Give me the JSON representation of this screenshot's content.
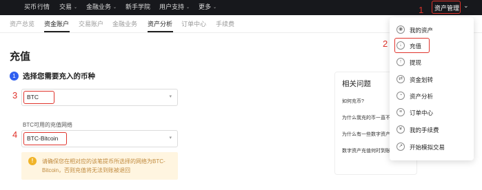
{
  "topnav": {
    "items": [
      {
        "label": "买币",
        "caret": false
      },
      {
        "label": "行情",
        "caret": false
      },
      {
        "label": "交易",
        "caret": true
      },
      {
        "label": "金融业务",
        "caret": true
      },
      {
        "label": "新手学院",
        "caret": false
      },
      {
        "label": "用户支持",
        "caret": true
      },
      {
        "label": "更多",
        "caret": true
      }
    ],
    "asset_management": "资产管理",
    "caret_glyph": "⌄",
    "user_icon": "⌄"
  },
  "annotations": [
    "1",
    "2",
    "3",
    "4"
  ],
  "subnav": {
    "tabs": [
      "资产总览",
      "资金账户",
      "交易账户",
      "金融业务",
      "资产分析",
      "订单中心",
      "手续费"
    ]
  },
  "main": {
    "title": "充值",
    "step": {
      "number": "1",
      "label": "选择您需要充入的币种"
    },
    "coin_value": "BTC",
    "network_label": "BTC可用的充值网络",
    "network_value": "BTC-Bitcoin",
    "notice": "请确保您在相对应的该笔提币所选择的网络为BTC-Bitcoin，否则充值将无法到账被退回"
  },
  "related": {
    "title": "相关问题",
    "questions": [
      "如何充币?",
      "为什么我充的币一直不到账",
      "为什么有一些数字资产",
      "数字资产充值何时到账?"
    ]
  },
  "dropdown": {
    "items": [
      {
        "label": "我的资产",
        "icon": "wallet-icon",
        "glyph": "◉"
      },
      {
        "label": "充值",
        "icon": "deposit-icon",
        "glyph": "↓"
      },
      {
        "label": "提现",
        "icon": "withdraw-icon",
        "glyph": "↑"
      },
      {
        "label": "资金划转",
        "icon": "transfer-icon",
        "glyph": "⇄"
      },
      {
        "label": "资产分析",
        "icon": "analysis-icon",
        "glyph": "◔"
      },
      {
        "label": "订单中心",
        "icon": "order-icon",
        "glyph": "≡"
      },
      {
        "label": "我的手续费",
        "icon": "fee-icon",
        "glyph": "¥"
      },
      {
        "label": "开始模拟交易",
        "icon": "simulation-icon",
        "glyph": "↗"
      }
    ]
  },
  "colors": {
    "accent": "#2f5ff0",
    "annotation_red": "#e0332b",
    "nav_bg": "#17181c",
    "notice_bg": "#fff5e0"
  }
}
